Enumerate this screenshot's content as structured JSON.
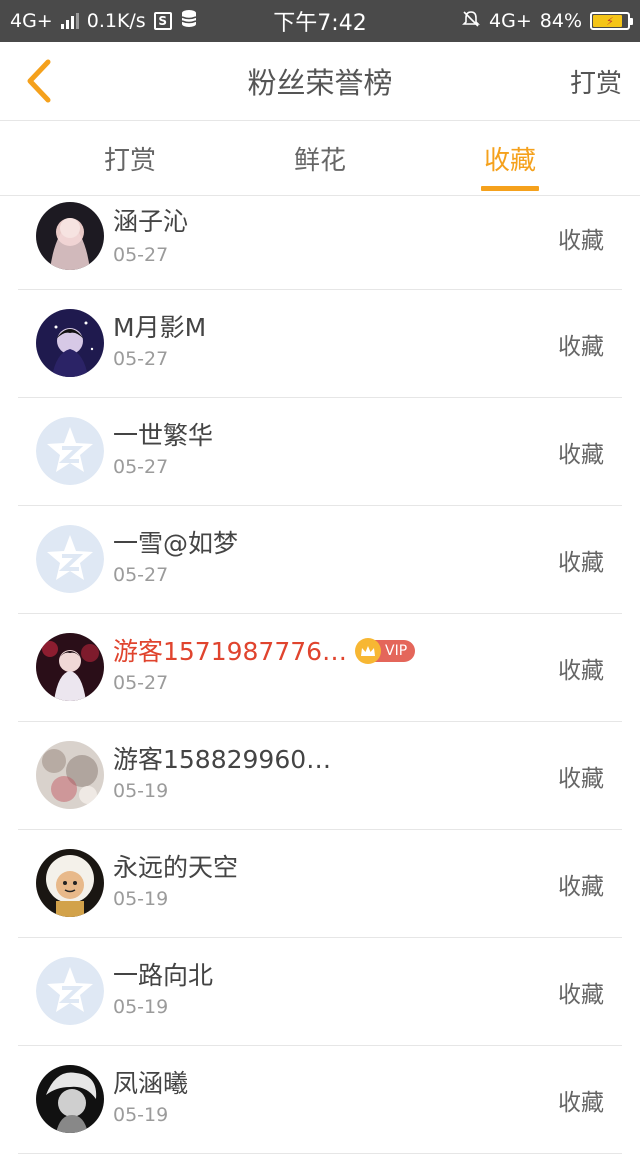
{
  "status_bar": {
    "network": "4G+",
    "speed": "0.1K/s",
    "time": "下午7:42",
    "network_right": "4G+",
    "battery": "84%",
    "battery_level": 0.84
  },
  "header": {
    "title": "粉丝荣誉榜",
    "right_action": "打赏"
  },
  "tabs": [
    {
      "label": "打赏",
      "active": false
    },
    {
      "label": "鲜花",
      "active": false
    },
    {
      "label": "收藏",
      "active": true
    }
  ],
  "list": [
    {
      "name": "涵子沁",
      "date": "05-27",
      "action": "收藏",
      "avatar": "photo-avatar-icon"
    },
    {
      "name": "M月影M",
      "date": "05-27",
      "action": "收藏",
      "avatar": "photo-avatar-icon"
    },
    {
      "name": "一世繁华",
      "date": "05-27",
      "action": "收藏",
      "avatar": "default-avatar-icon"
    },
    {
      "name": "一雪@如梦",
      "date": "05-27",
      "action": "收藏",
      "avatar": "default-avatar-icon"
    },
    {
      "name": "游客1571987776…",
      "date": "05-27",
      "action": "收藏",
      "avatar": "photo-avatar-icon",
      "vip": "VIP"
    },
    {
      "name": "游客158829960…",
      "date": "05-19",
      "action": "收藏",
      "avatar": "photo-avatar-icon"
    },
    {
      "name": "永远的天空",
      "date": "05-19",
      "action": "收藏",
      "avatar": "photo-avatar-icon"
    },
    {
      "name": "一路向北",
      "date": "05-19",
      "action": "收藏",
      "avatar": "default-avatar-icon"
    },
    {
      "name": "凤涵曦",
      "date": "05-19",
      "action": "收藏",
      "avatar": "photo-avatar-icon"
    }
  ],
  "colors": {
    "accent": "#f5a11c",
    "vip_name": "#e0442e",
    "status_bar_bg": "#4a4a4a",
    "default_avatar": "#dfe8f4"
  }
}
